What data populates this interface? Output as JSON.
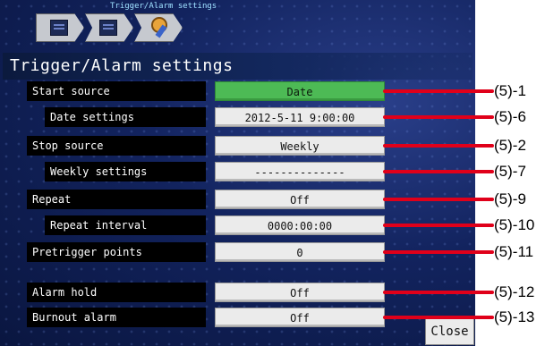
{
  "header": {
    "breadcrumb": "Trigger/Alarm settings",
    "title": "Trigger/Alarm settings"
  },
  "tabs": [
    {
      "icon": "screen-icon"
    },
    {
      "icon": "list-icon"
    },
    {
      "icon": "settings-icon"
    }
  ],
  "rows": [
    {
      "label": "Start source",
      "value": "Date",
      "callout": "(5)-1"
    },
    {
      "label": "Date settings",
      "value": "2012-5-11 9:00:00",
      "callout": "(5)-6"
    },
    {
      "label": "Stop source",
      "value": "Weekly",
      "callout": "(5)-2"
    },
    {
      "label": "Weekly settings",
      "value": "--------------",
      "callout": "(5)-7"
    },
    {
      "label": "Repeat",
      "value": "Off",
      "callout": "(5)-9"
    },
    {
      "label": "Repeat interval",
      "value": "0000:00:00",
      "callout": "(5)-10"
    },
    {
      "label": "Pretrigger points",
      "value": "0",
      "callout": "(5)-11"
    },
    {
      "label": "Alarm hold",
      "value": "Off",
      "callout": "(5)-12"
    },
    {
      "label": "Burnout alarm",
      "value": "Off",
      "callout": "(5)-13"
    }
  ],
  "close_label": "Close",
  "colors": {
    "accent_green": "#4dba55",
    "callout_red": "#e0001a"
  }
}
